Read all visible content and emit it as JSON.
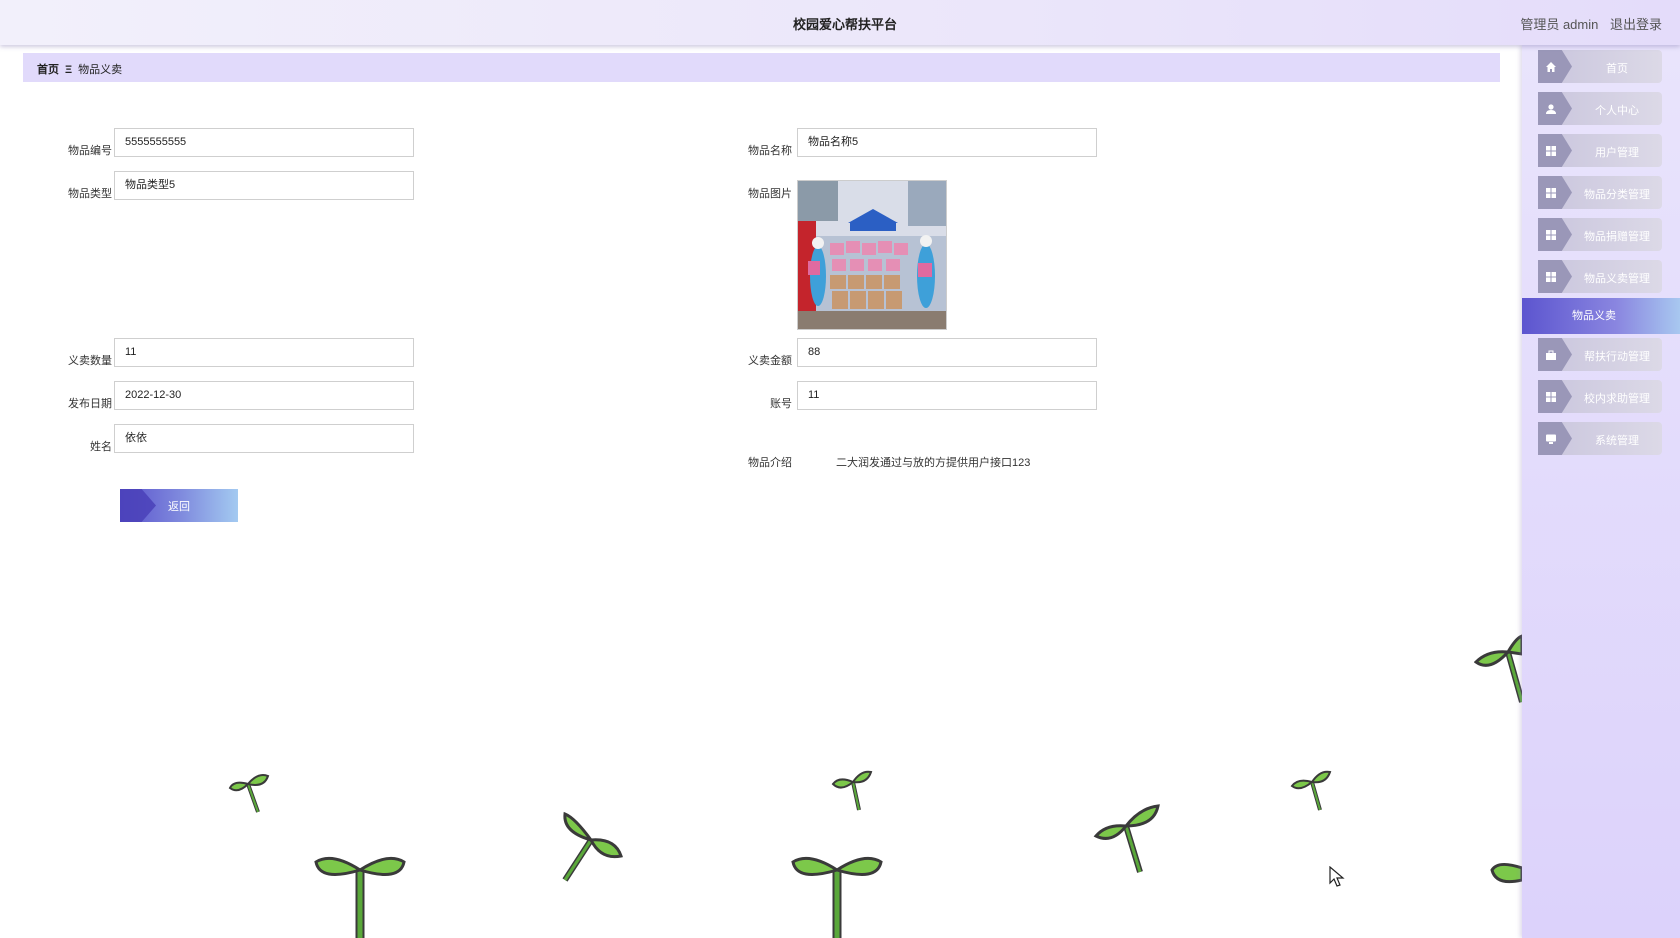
{
  "header": {
    "title": "校园爱心帮扶平台",
    "user_label": "管理员 admin",
    "logout": "退出登录"
  },
  "breadcrumb": {
    "home": "首页",
    "separator": "Ξ",
    "current": "物品义卖"
  },
  "sidebar": {
    "items": [
      {
        "label": "首页",
        "icon": "home-icon"
      },
      {
        "label": "个人中心",
        "icon": "user-icon"
      },
      {
        "label": "用户管理",
        "icon": "grid-icon"
      },
      {
        "label": "物品分类管理",
        "icon": "grid-icon"
      },
      {
        "label": "物品捐赠管理",
        "icon": "grid-icon"
      },
      {
        "label": "物品义卖管理",
        "icon": "grid-icon"
      }
    ],
    "active": "物品义卖",
    "items_after": [
      {
        "label": "帮扶行动管理",
        "icon": "briefcase-icon"
      },
      {
        "label": "校内求助管理",
        "icon": "grid-icon"
      },
      {
        "label": "系统管理",
        "icon": "monitor-icon"
      }
    ]
  },
  "form": {
    "item_no": {
      "label": "物品编号",
      "value": "5555555555"
    },
    "item_name": {
      "label": "物品名称",
      "value": "物品名称5"
    },
    "item_type": {
      "label": "物品类型",
      "value": "物品类型5"
    },
    "item_image": {
      "label": "物品图片"
    },
    "sale_qty": {
      "label": "义卖数量",
      "value": "11"
    },
    "sale_amount": {
      "label": "义卖金额",
      "value": "88"
    },
    "publish_date": {
      "label": "发布日期",
      "value": "2022-12-30"
    },
    "account": {
      "label": "账号",
      "value": "11"
    },
    "name": {
      "label": "姓名",
      "value": "依依"
    },
    "intro": {
      "label": "物品介绍",
      "value": "二大润发通过与放的方提供用户接口123"
    },
    "back_label": "返回"
  },
  "colors": {
    "accent": "#5c55cf",
    "breadcrumb_bg": "#e1dafb",
    "sidebar_bg": "#e4dcfa",
    "sprout_green": "#7cc84a"
  }
}
